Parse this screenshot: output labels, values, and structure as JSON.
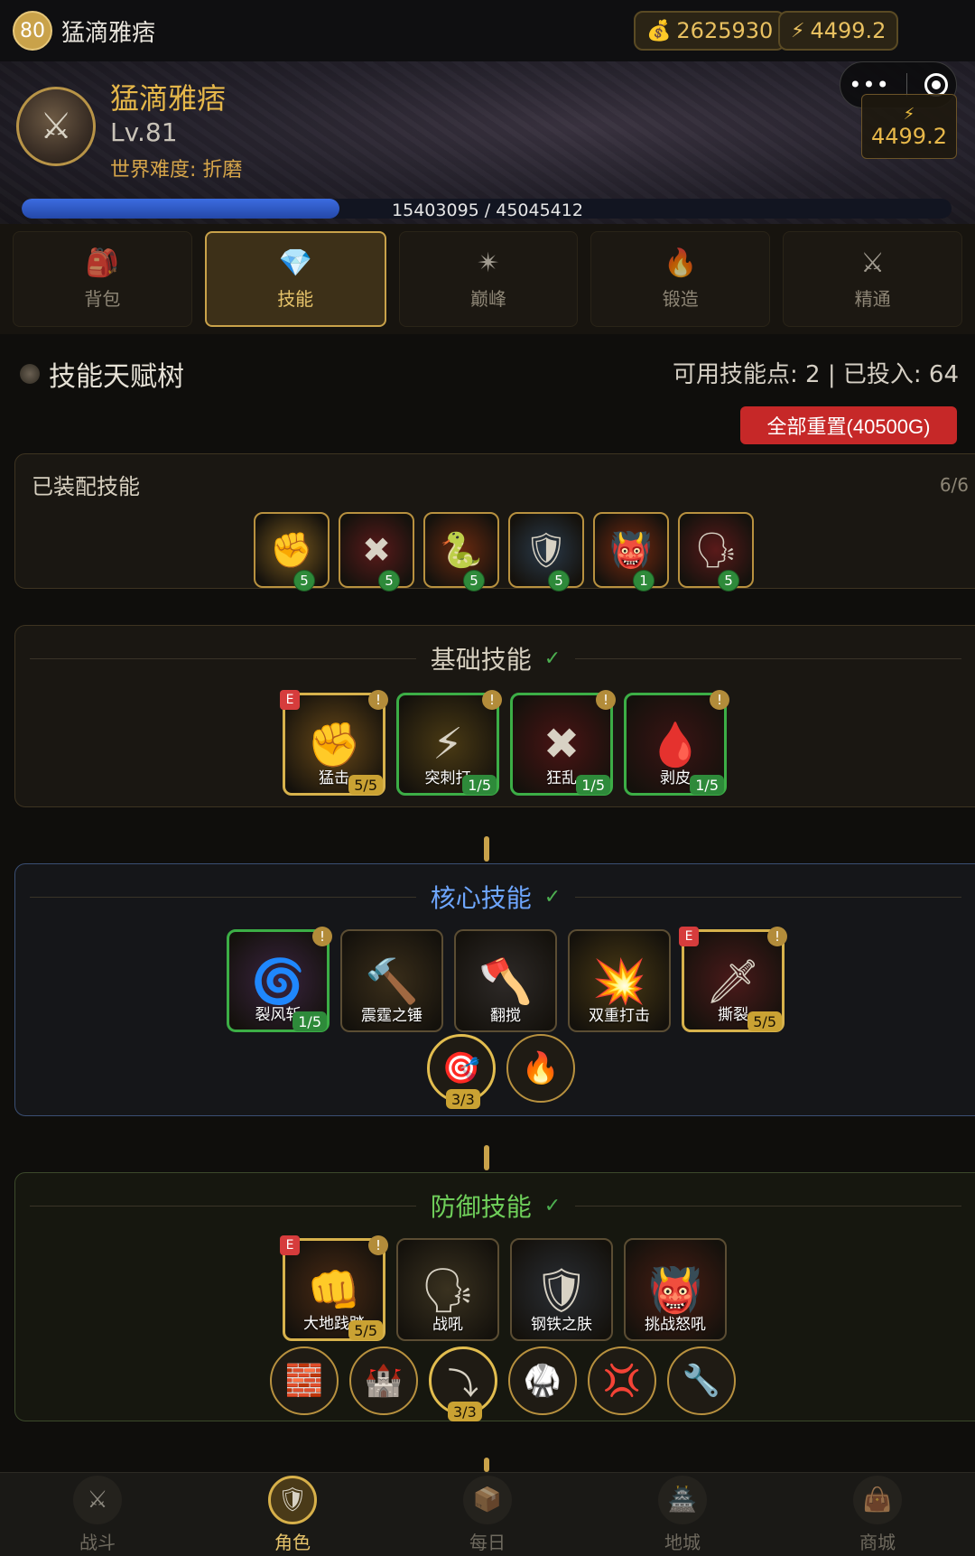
{
  "topbar": {
    "level": "80",
    "player_name": "猛滴雅痞",
    "gold": "2625930",
    "power": "4499.2"
  },
  "header": {
    "name": "猛滴雅痞",
    "level": "Lv.81",
    "difficulty": "世界难度: 折磨",
    "power": "4499.2",
    "xp_text": "15403095 / 45045412",
    "xp_progress": 0.342
  },
  "tabs": [
    {
      "label": "背包",
      "icon": "backpack-icon",
      "glyph": "🎒",
      "active": false
    },
    {
      "label": "技能",
      "icon": "skill-gem-icon",
      "glyph": "💎",
      "active": true
    },
    {
      "label": "巅峰",
      "icon": "paragon-star-icon",
      "glyph": "✴",
      "active": false
    },
    {
      "label": "锻造",
      "icon": "forge-icon",
      "glyph": "🔥",
      "active": false
    },
    {
      "label": "精通",
      "icon": "crossed-swords-icon",
      "glyph": "⚔",
      "active": false
    }
  ],
  "skill_tree": {
    "title": "技能天赋树",
    "points_text": "可用技能点: 2 | 已投入: 64",
    "reset_label": "全部重置(40500G)"
  },
  "equipped": {
    "title": "已装配技能",
    "count": "6/6",
    "skills": [
      {
        "level": "5",
        "glyph": "✊",
        "color": "#7a5a1e"
      },
      {
        "level": "5",
        "glyph": "✖",
        "color": "#5a1a1a"
      },
      {
        "level": "5",
        "glyph": "🐍",
        "color": "#6a2a10"
      },
      {
        "level": "5",
        "glyph": "🛡",
        "color": "#2a3a4a"
      },
      {
        "level": "1",
        "glyph": "👹",
        "color": "#7a2a10"
      },
      {
        "level": "5",
        "glyph": "🗣",
        "color": "#5a1a1a"
      }
    ]
  },
  "categories": {
    "basic": {
      "label": "基础技能",
      "skills": [
        {
          "name": "猛击",
          "level": "5/5",
          "state": "gold",
          "e": true,
          "excl": true,
          "glyph": "✊",
          "color": "#6a4a18"
        },
        {
          "name": "突刺打",
          "level": "1/5",
          "state": "green",
          "e": false,
          "excl": true,
          "glyph": "⚡",
          "color": "#4a3a14"
        },
        {
          "name": "狂乱",
          "level": "1/5",
          "state": "green",
          "e": false,
          "excl": true,
          "glyph": "✖",
          "color": "#4a1414"
        },
        {
          "name": "剥皮",
          "level": "1/5",
          "state": "green",
          "e": false,
          "excl": true,
          "glyph": "🩸",
          "color": "#3a1414"
        }
      ]
    },
    "core": {
      "label": "核心技能",
      "skills": [
        {
          "name": "裂风斩",
          "level": "1/5",
          "state": "green",
          "e": false,
          "excl": true,
          "glyph": "🌀",
          "color": "#3a2440"
        },
        {
          "name": "震霆之锤",
          "level": "",
          "state": "plain",
          "e": false,
          "excl": false,
          "glyph": "🔨",
          "color": "#3a2e1a"
        },
        {
          "name": "翻搅",
          "level": "",
          "state": "plain",
          "e": false,
          "excl": false,
          "glyph": "🪓",
          "color": "#2e2a28"
        },
        {
          "name": "双重打击",
          "level": "",
          "state": "plain",
          "e": false,
          "excl": false,
          "glyph": "💥",
          "color": "#4a3a14"
        },
        {
          "name": "撕裂",
          "level": "5/5",
          "state": "gold",
          "e": true,
          "excl": true,
          "glyph": "🗡",
          "color": "#4a1a1a"
        }
      ],
      "modifiers": [
        {
          "glyph": "🎯",
          "icon": "target-icon",
          "level": "3/3",
          "active": true
        },
        {
          "glyph": "🔥",
          "icon": "fire-icon",
          "level": "",
          "active": false
        }
      ]
    },
    "defense": {
      "label": "防御技能",
      "skills": [
        {
          "name": "大地践踏",
          "level": "5/5",
          "state": "gold",
          "e": true,
          "excl": true,
          "glyph": "👊",
          "color": "#4a2a14"
        },
        {
          "name": "战吼",
          "level": "",
          "state": "plain",
          "e": false,
          "excl": false,
          "glyph": "🗣",
          "color": "#3a3220"
        },
        {
          "name": "钢铁之肤",
          "level": "",
          "state": "plain",
          "e": false,
          "excl": false,
          "glyph": "🛡",
          "color": "#2a2e34"
        },
        {
          "name": "挑战怒吼",
          "level": "",
          "state": "plain",
          "e": false,
          "excl": false,
          "glyph": "👹",
          "color": "#4a1e14"
        }
      ],
      "modifiers": [
        {
          "glyph": "🧱",
          "icon": "brick-icon",
          "level": "",
          "active": false
        },
        {
          "glyph": "🏰",
          "icon": "castle-icon",
          "level": "",
          "active": false
        },
        {
          "glyph": "⤵",
          "icon": "rotate-icon",
          "level": "3/3",
          "active": true
        },
        {
          "glyph": "🥋",
          "icon": "martial-arts-icon",
          "level": "",
          "active": false
        },
        {
          "glyph": "💢",
          "icon": "anger-icon",
          "level": "",
          "active": false
        },
        {
          "glyph": "🔧",
          "icon": "wrench-icon",
          "level": "",
          "active": false
        }
      ]
    }
  },
  "bottom_nav": [
    {
      "label": "战斗",
      "icon": "battle-icon",
      "glyph": "⚔",
      "active": false
    },
    {
      "label": "角色",
      "icon": "character-icon",
      "glyph": "🛡",
      "active": true
    },
    {
      "label": "每日",
      "icon": "daily-chest-icon",
      "glyph": "📦",
      "active": false
    },
    {
      "label": "地城",
      "icon": "dungeon-icon",
      "glyph": "🏯",
      "active": false
    },
    {
      "label": "商城",
      "icon": "shop-bag-icon",
      "glyph": "👜",
      "active": false
    }
  ]
}
